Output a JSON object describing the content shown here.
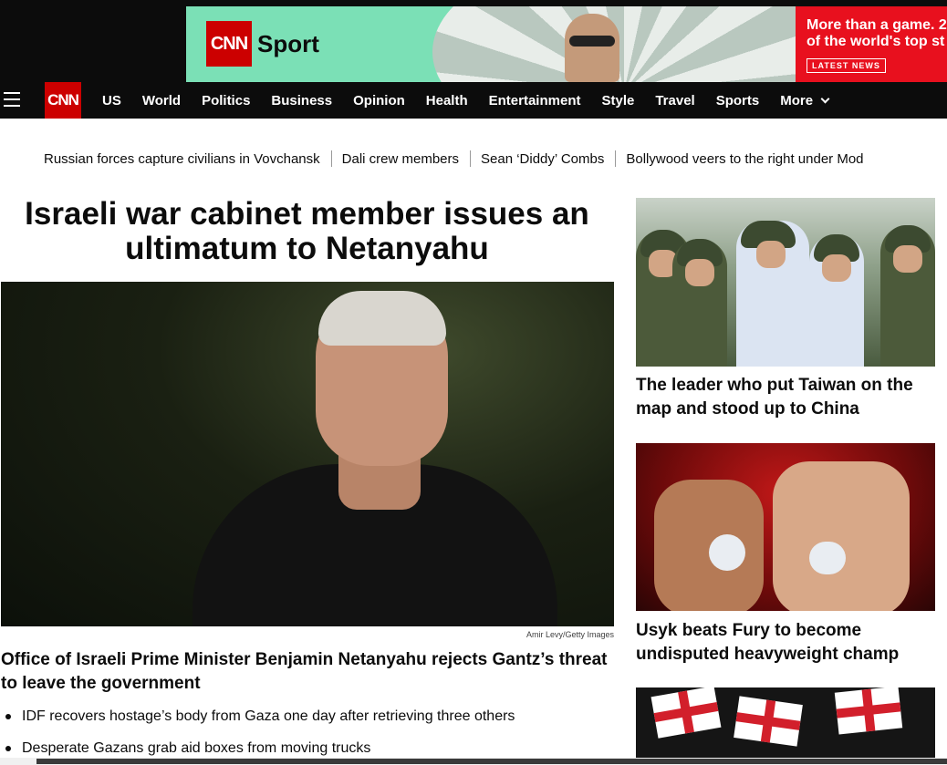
{
  "ad": {
    "brand": "CNN",
    "sport_label": "Sport",
    "headline_line1": "More than a game. 2",
    "headline_line2": "of the world's top st",
    "cta": "LATEST NEWS",
    "colors": {
      "banner_bg": "#7be0b6",
      "brand_red": "#cc0000",
      "cta_bg": "#e8101e"
    }
  },
  "nav": {
    "logo": "CNN",
    "items": [
      "US",
      "World",
      "Politics",
      "Business",
      "Opinion",
      "Health",
      "Entertainment",
      "Style",
      "Travel",
      "Sports"
    ],
    "more_label": "More"
  },
  "trending": [
    "Russian forces capture civilians in Vovchansk",
    "Dali crew members",
    "Sean ‘Diddy’ Combs",
    "Bollywood veers to the right under Mod"
  ],
  "lead": {
    "title": "Israeli war cabinet member issues an ultimatum to Netanyahu",
    "image_credit": "Amir Levy/Getty Images",
    "subheadline": "Office of Israeli Prime Minister Benjamin Netanyahu rejects Gantz’s threat to leave the government",
    "bullets": [
      "IDF recovers hostage’s body from Gaza one day after retrieving three others",
      "Desperate Gazans grab aid boxes from moving trucks"
    ]
  },
  "sidebar": {
    "stories": [
      {
        "title": "The leader who put Taiwan on the map and stood up to China"
      },
      {
        "title": "Usyk beats Fury to become undisputed heavyweight champ"
      }
    ]
  }
}
